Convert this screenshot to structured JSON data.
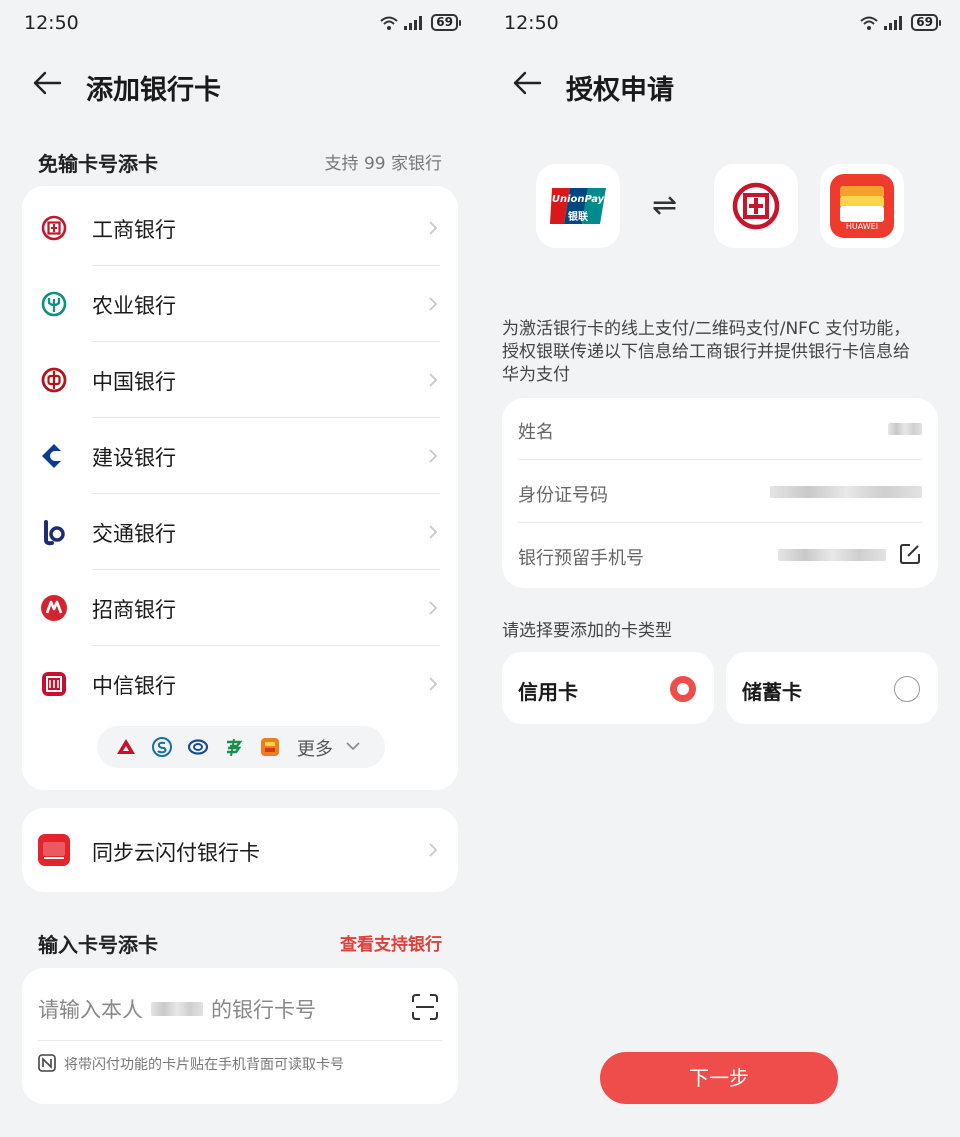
{
  "left": {
    "status": {
      "time": "12:50",
      "battery": "69"
    },
    "title": "添加银行卡",
    "quick_section": {
      "title": "免输卡号添卡",
      "support_text": "支持 99 家银行"
    },
    "banks": [
      {
        "name": "工商银行",
        "icon": "icbc-icon",
        "color": "#c7162b"
      },
      {
        "name": "农业银行",
        "icon": "abc-icon",
        "color": "#0f8f7c"
      },
      {
        "name": "中国银行",
        "icon": "boc-icon",
        "color": "#b5121b"
      },
      {
        "name": "建设银行",
        "icon": "ccb-icon",
        "color": "#0a3d8f"
      },
      {
        "name": "交通银行",
        "icon": "bocom-icon",
        "color": "#1d2e6e"
      },
      {
        "name": "招商银行",
        "icon": "cmb-icon",
        "color": "#d3232e"
      },
      {
        "name": "中信银行",
        "icon": "citic-icon",
        "color": "#c8102e"
      }
    ],
    "more_label": "更多",
    "sync_label": "同步云闪付银行卡",
    "manual_section": {
      "title": "输入卡号添卡",
      "link": "查看支持银行"
    },
    "card_input": {
      "prefix": "请输入本人",
      "suffix": "的银行卡号"
    },
    "nfc_hint": "将带闪付功能的卡片贴在手机背面可读取卡号"
  },
  "right": {
    "status": {
      "time": "12:50",
      "battery": "69"
    },
    "title": "授权申请",
    "logos": {
      "unionpay_text": "UnionPay",
      "unionpay_cn": "银联",
      "huawei_text": "HUAWEI",
      "swap": "⇌"
    },
    "info": "为激活银行卡的线上支付/二维码支付/NFC 支付功能，授权银联传递以下信息给工商银行并提供银行卡信息给华为支付",
    "fields": [
      {
        "label": "姓名"
      },
      {
        "label": "身份证号码"
      },
      {
        "label": "银行预留手机号"
      }
    ],
    "card_type_title": "请选择要添加的卡类型",
    "card_types": [
      {
        "label": "信用卡",
        "selected": true
      },
      {
        "label": "储蓄卡",
        "selected": false
      }
    ],
    "next_button": "下一步"
  },
  "colors": {
    "accent": "#ee4d4b",
    "link": "#e0403b",
    "background": "#f1f3f5"
  }
}
